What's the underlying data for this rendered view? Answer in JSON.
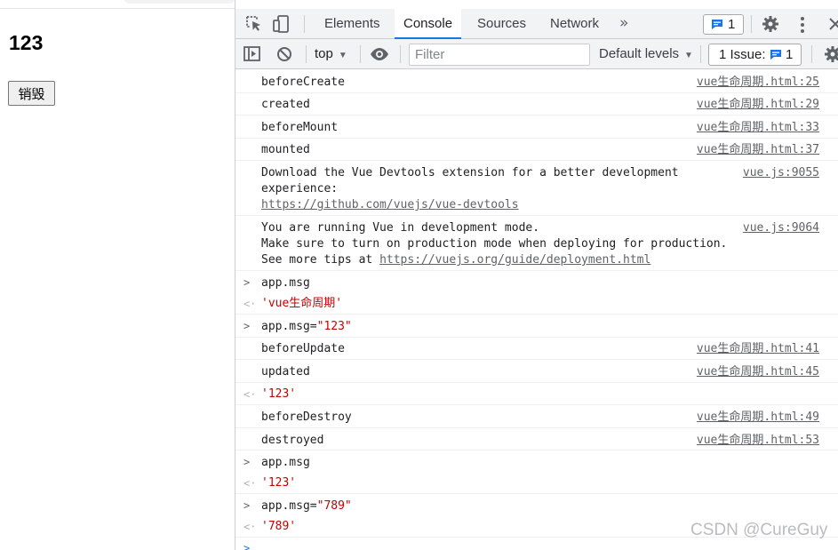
{
  "page": {
    "heading": "123",
    "destroy_button": "销毁"
  },
  "devtools": {
    "tabs": [
      "Elements",
      "Console",
      "Sources",
      "Network"
    ],
    "active_tab": "Console",
    "more_tabs_glyph": "»",
    "messages_badge_count": "1",
    "toolbar": {
      "context": "top",
      "filter_placeholder": "Filter",
      "levels": "Default levels",
      "issues_label": "1 Issue:",
      "issues_count": "1"
    },
    "console": {
      "rows": [
        {
          "kind": "log",
          "text": "beforeCreate",
          "source": "vue生命周期.html:25"
        },
        {
          "kind": "log",
          "text": "created",
          "source": "vue生命周期.html:29"
        },
        {
          "kind": "log",
          "text": "beforeMount",
          "source": "vue生命周期.html:33"
        },
        {
          "kind": "log",
          "text": "mounted",
          "source": "vue生命周期.html:37"
        },
        {
          "kind": "log",
          "lines": [
            "Download the Vue Devtools extension for a better development",
            "experience:"
          ],
          "link": "https://github.com/vuejs/vue-devtools",
          "source": "vue.js:9055"
        },
        {
          "kind": "log",
          "lines": [
            "You are running Vue in development mode.",
            "Make sure to turn on production mode when deploying for production."
          ],
          "prefix": "See more tips at ",
          "link": "https://vuejs.org/guide/deployment.html",
          "source": "vue.js:9064"
        },
        {
          "kind": "input",
          "text": "app.msg"
        },
        {
          "kind": "result",
          "text": "'vue生命周期'"
        },
        {
          "kind": "input",
          "text": "app.msg=",
          "string": "\"123\""
        },
        {
          "kind": "log",
          "text": "beforeUpdate",
          "source": "vue生命周期.html:41"
        },
        {
          "kind": "log",
          "text": "updated",
          "source": "vue生命周期.html:45"
        },
        {
          "kind": "result",
          "text": "'123'"
        },
        {
          "kind": "log",
          "text": "beforeDestroy",
          "source": "vue生命周期.html:49"
        },
        {
          "kind": "log",
          "text": "destroyed",
          "source": "vue生命周期.html:53"
        },
        {
          "kind": "input",
          "text": "app.msg"
        },
        {
          "kind": "result",
          "text": "'123'"
        },
        {
          "kind": "input",
          "text": "app.msg=",
          "string": "\"789\""
        },
        {
          "kind": "result",
          "text": "'789'"
        }
      ]
    }
  },
  "watermark": "CSDN @CureGuy",
  "icons": {
    "inspect": "inspect-element-icon",
    "device": "device-toolbar-icon",
    "sidebar": "sidebar-toggle-icon",
    "clear": "clear-console-icon",
    "eye": "live-expression-icon",
    "settings": "gear-icon",
    "menu": "kebab-menu-icon",
    "close": "close-icon",
    "message": "message-icon"
  },
  "colors": {
    "accent": "#1a73e8",
    "string": "#c80000",
    "chrome_bg": "#f1f3f4"
  }
}
